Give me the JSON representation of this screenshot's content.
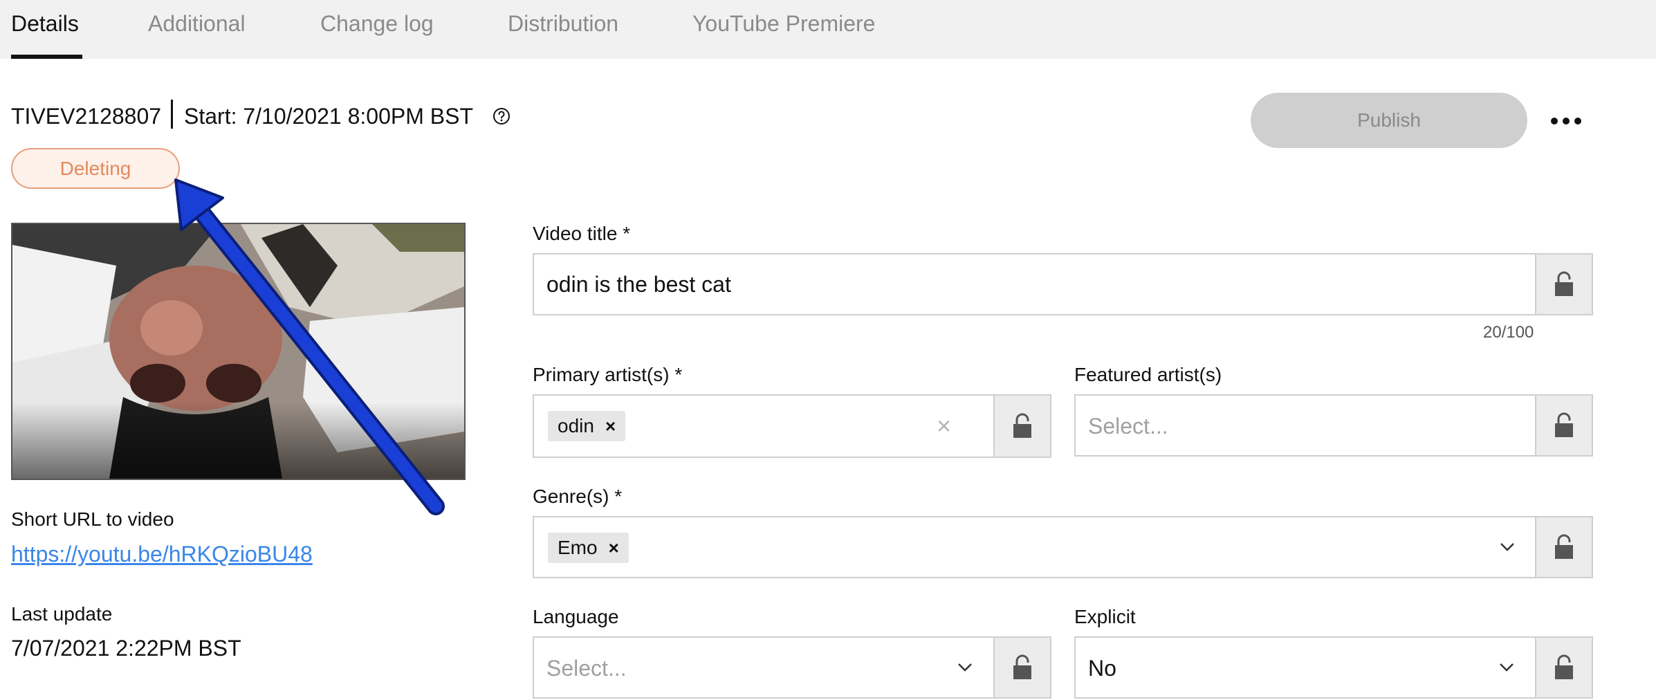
{
  "tabs": [
    {
      "label": "Details",
      "active": true
    },
    {
      "label": "Additional",
      "active": false
    },
    {
      "label": "Change log",
      "active": false
    },
    {
      "label": "Distribution",
      "active": false
    },
    {
      "label": "YouTube Premiere",
      "active": false
    }
  ],
  "header": {
    "event_id": "TIVEV2128807",
    "start_time": "Start: 7/10/2021 8:00PM BST",
    "status": "Deleting",
    "publish_label": "Publish"
  },
  "sidebar": {
    "short_url_label": "Short URL to video",
    "short_url": "https://youtu.be/hRKQzioBU48",
    "last_update_label": "Last update",
    "last_update": "7/07/2021 2:22PM BST"
  },
  "form": {
    "video_title": {
      "label": "Video title *",
      "value": "odin is the best cat",
      "counter": "20/100"
    },
    "primary_artists": {
      "label": "Primary artist(s) *",
      "chips": [
        "odin"
      ]
    },
    "featured_artists": {
      "label": "Featured artist(s)",
      "placeholder": "Select..."
    },
    "genres": {
      "label": "Genre(s) *",
      "chips": [
        "Emo"
      ]
    },
    "language": {
      "label": "Language",
      "placeholder": "Select..."
    },
    "explicit": {
      "label": "Explicit",
      "value": "No"
    }
  },
  "icons": {
    "help": "question-circle-icon",
    "more": "ellipsis-icon",
    "lock": "lock-icon",
    "chevron": "chevron-down-icon",
    "chip_remove": "close-icon"
  },
  "colors": {
    "status_border": "#e79f7b",
    "status_text": "#e3895c",
    "link": "#3a86e8",
    "annotation_arrow": "#1a3fd6",
    "publish_disabled": "#cfcfcf"
  }
}
